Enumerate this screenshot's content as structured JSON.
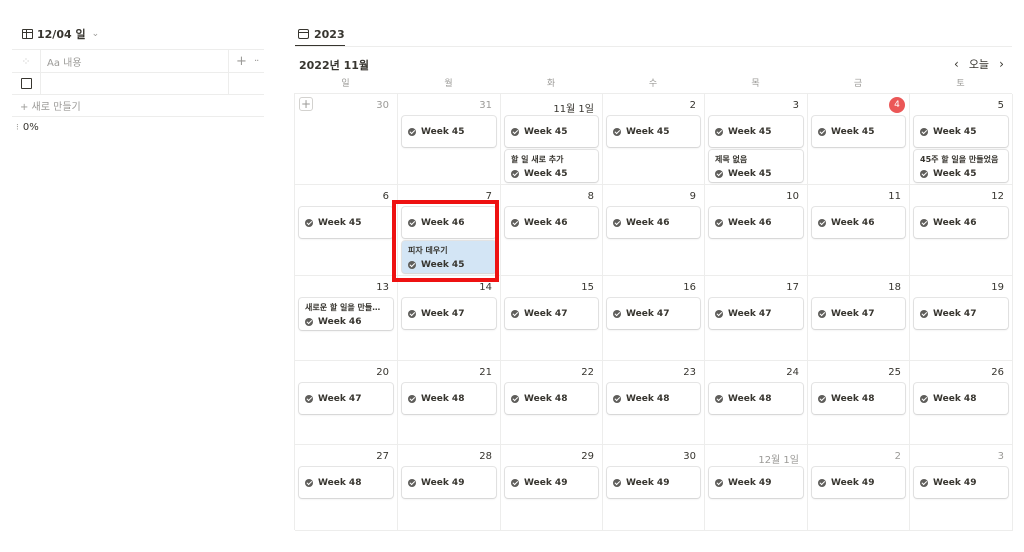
{
  "left": {
    "tab_label": "12/04 일",
    "name_header": "Aa 내용",
    "plus": "+",
    "more": "··",
    "new_row": "+ 새로 만들기",
    "percent": "0%"
  },
  "calendar": {
    "tab_label": "2023",
    "month_title": "2022년 11월",
    "today_label": "오늘",
    "prev": "‹",
    "next": "›",
    "weekdays": [
      "일",
      "월",
      "화",
      "수",
      "목",
      "금",
      "토"
    ],
    "today_color": "#eb5757",
    "highlight_color": "#d3e5f5",
    "annotation_color": "#ee1111",
    "weeks": [
      {
        "days": [
          {
            "num": "30",
            "muted": true,
            "add": "+",
            "cards": []
          },
          {
            "num": "31",
            "muted": true,
            "cards": [
              {
                "week": "Week 45"
              }
            ]
          },
          {
            "num": "11월 1일",
            "cards": [
              {
                "week": "Week 45"
              },
              {
                "title": "할 일 새로 추가",
                "week": "Week 45"
              }
            ]
          },
          {
            "num": "2",
            "cards": [
              {
                "week": "Week 45"
              }
            ]
          },
          {
            "num": "3",
            "cards": [
              {
                "week": "Week 45"
              },
              {
                "title": "제목 없음",
                "week": "Week 45"
              }
            ]
          },
          {
            "num": "4",
            "today": true,
            "cards": [
              {
                "week": "Week 45"
              }
            ]
          },
          {
            "num": "5",
            "cards": [
              {
                "week": "Week 45"
              },
              {
                "title": "45주 할 일을 만들었음",
                "week": "Week 45"
              }
            ]
          }
        ]
      },
      {
        "days": [
          {
            "num": "6",
            "cards": [
              {
                "week": "Week 45"
              }
            ]
          },
          {
            "num": "7",
            "cards": [
              {
                "week": "Week 46"
              },
              {
                "title": "피자 데우기",
                "week": "Week 45",
                "highlight": true
              }
            ]
          },
          {
            "num": "8",
            "cards": [
              {
                "week": "Week 46"
              }
            ]
          },
          {
            "num": "9",
            "cards": [
              {
                "week": "Week 46"
              }
            ]
          },
          {
            "num": "10",
            "cards": [
              {
                "week": "Week 46"
              }
            ]
          },
          {
            "num": "11",
            "cards": [
              {
                "week": "Week 46"
              }
            ]
          },
          {
            "num": "12",
            "cards": [
              {
                "week": "Week 46"
              }
            ]
          }
        ]
      },
      {
        "days": [
          {
            "num": "13",
            "cards": [
              {
                "title": "새로운 할 일을 만들어 ...",
                "week": "Week 46"
              }
            ]
          },
          {
            "num": "14",
            "cards": [
              {
                "week": "Week 47"
              }
            ]
          },
          {
            "num": "15",
            "cards": [
              {
                "week": "Week 47"
              }
            ]
          },
          {
            "num": "16",
            "cards": [
              {
                "week": "Week 47"
              }
            ]
          },
          {
            "num": "17",
            "cards": [
              {
                "week": "Week 47"
              }
            ]
          },
          {
            "num": "18",
            "cards": [
              {
                "week": "Week 47"
              }
            ]
          },
          {
            "num": "19",
            "cards": [
              {
                "week": "Week 47"
              }
            ]
          }
        ]
      },
      {
        "days": [
          {
            "num": "20",
            "cards": [
              {
                "week": "Week 47"
              }
            ]
          },
          {
            "num": "21",
            "cards": [
              {
                "week": "Week 48"
              }
            ]
          },
          {
            "num": "22",
            "cards": [
              {
                "week": "Week 48"
              }
            ]
          },
          {
            "num": "23",
            "cards": [
              {
                "week": "Week 48"
              }
            ]
          },
          {
            "num": "24",
            "cards": [
              {
                "week": "Week 48"
              }
            ]
          },
          {
            "num": "25",
            "cards": [
              {
                "week": "Week 48"
              }
            ]
          },
          {
            "num": "26",
            "cards": [
              {
                "week": "Week 48"
              }
            ]
          }
        ]
      },
      {
        "days": [
          {
            "num": "27",
            "cards": [
              {
                "week": "Week 48"
              }
            ]
          },
          {
            "num": "28",
            "cards": [
              {
                "week": "Week 49"
              }
            ]
          },
          {
            "num": "29",
            "cards": [
              {
                "week": "Week 49"
              }
            ]
          },
          {
            "num": "30",
            "cards": [
              {
                "week": "Week 49"
              }
            ]
          },
          {
            "num": "12월 1일",
            "muted": true,
            "cards": [
              {
                "week": "Week 49"
              }
            ]
          },
          {
            "num": "2",
            "muted": true,
            "cards": [
              {
                "week": "Week 49"
              }
            ]
          },
          {
            "num": "3",
            "muted": true,
            "cards": [
              {
                "week": "Week 49"
              }
            ]
          }
        ]
      }
    ]
  }
}
